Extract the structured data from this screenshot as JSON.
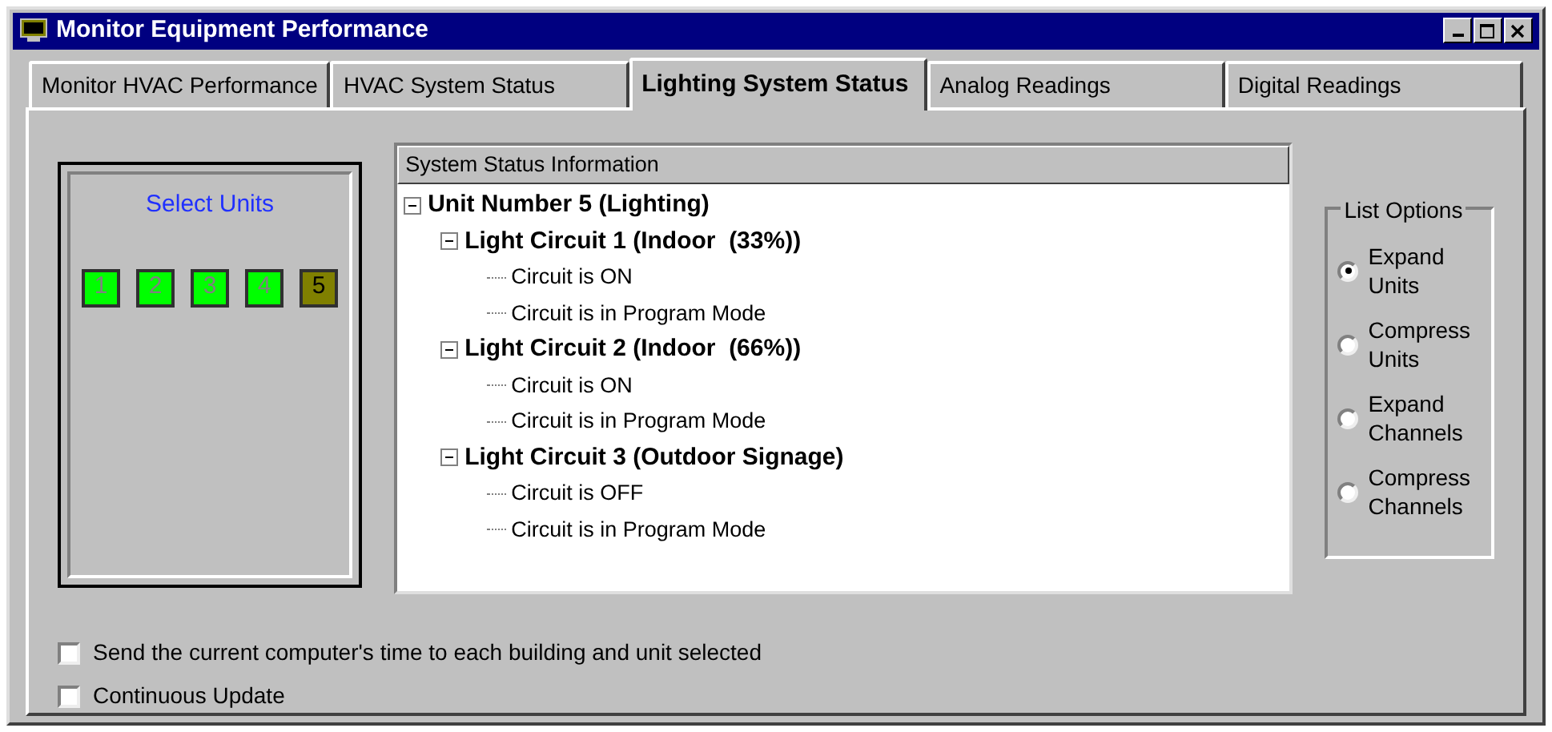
{
  "window": {
    "title": "Monitor Equipment Performance"
  },
  "tabs": [
    {
      "label": "Monitor HVAC Performance",
      "selected": false
    },
    {
      "label": "HVAC System Status",
      "selected": false
    },
    {
      "label": "Lighting System Status",
      "selected": true
    },
    {
      "label": "Analog Readings",
      "selected": false
    },
    {
      "label": "Digital Readings",
      "selected": false
    }
  ],
  "select_units": {
    "title": "Select Units",
    "units": [
      {
        "label": "1",
        "selected": false
      },
      {
        "label": "2",
        "selected": false
      },
      {
        "label": "3",
        "selected": false
      },
      {
        "label": "4",
        "selected": false
      },
      {
        "label": "5",
        "selected": true
      }
    ]
  },
  "status_tree": {
    "header": "System Status Information",
    "items": [
      {
        "label": "Unit Number 5 (Lighting)",
        "expanded": true,
        "children": [
          {
            "label": "Light Circuit 1 (Indoor  (33%))",
            "expanded": true,
            "children": [
              {
                "label": "Circuit is ON"
              },
              {
                "label": "Circuit is in Program Mode"
              }
            ]
          },
          {
            "label": "Light Circuit 2 (Indoor  (66%))",
            "expanded": true,
            "children": [
              {
                "label": "Circuit is ON"
              },
              {
                "label": "Circuit is in Program Mode"
              }
            ]
          },
          {
            "label": "Light Circuit 3 (Outdoor Signage)",
            "expanded": true,
            "children": [
              {
                "label": "Circuit is OFF"
              },
              {
                "label": "Circuit is in Program Mode"
              }
            ]
          }
        ]
      }
    ]
  },
  "list_options": {
    "title": "List Options",
    "options": [
      {
        "label": "Expand Units",
        "selected": true
      },
      {
        "label": "Compress Units",
        "selected": false
      },
      {
        "label": "Expand Channels",
        "selected": false
      },
      {
        "label": "Compress Channels",
        "selected": false
      }
    ]
  },
  "checkboxes": [
    {
      "label": "Send the current computer's time to each building and unit selected",
      "checked": false
    },
    {
      "label": "Continuous Update",
      "checked": false
    }
  ]
}
